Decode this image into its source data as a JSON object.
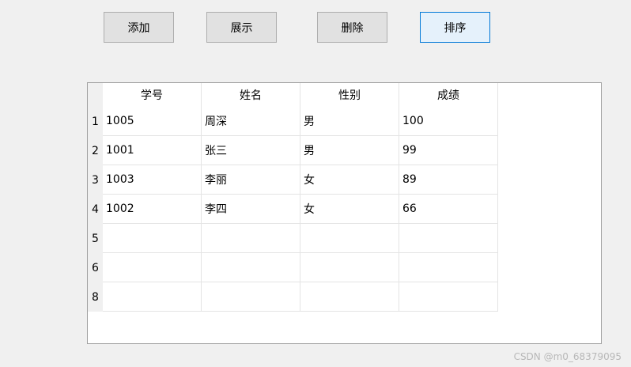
{
  "toolbar": {
    "add_label": "添加",
    "show_label": "展示",
    "delete_label": "删除",
    "sort_label": "排序"
  },
  "table": {
    "columns": [
      "学号",
      "姓名",
      "性别",
      "成绩"
    ],
    "rows": [
      {
        "num": "1",
        "cells": [
          "1005",
          "周深",
          "男",
          "100"
        ]
      },
      {
        "num": "2",
        "cells": [
          "1001",
          "张三",
          "男",
          "99"
        ]
      },
      {
        "num": "3",
        "cells": [
          "1003",
          "李丽",
          "女",
          "89"
        ]
      },
      {
        "num": "4",
        "cells": [
          "1002",
          "李四",
          "女",
          "66"
        ]
      },
      {
        "num": "5",
        "cells": [
          "",
          "",
          "",
          ""
        ]
      },
      {
        "num": "6",
        "cells": [
          "",
          "",
          "",
          ""
        ]
      },
      {
        "num": "8",
        "cells": [
          "",
          "",
          "",
          ""
        ]
      }
    ]
  },
  "watermark": "CSDN @m0_68379095"
}
